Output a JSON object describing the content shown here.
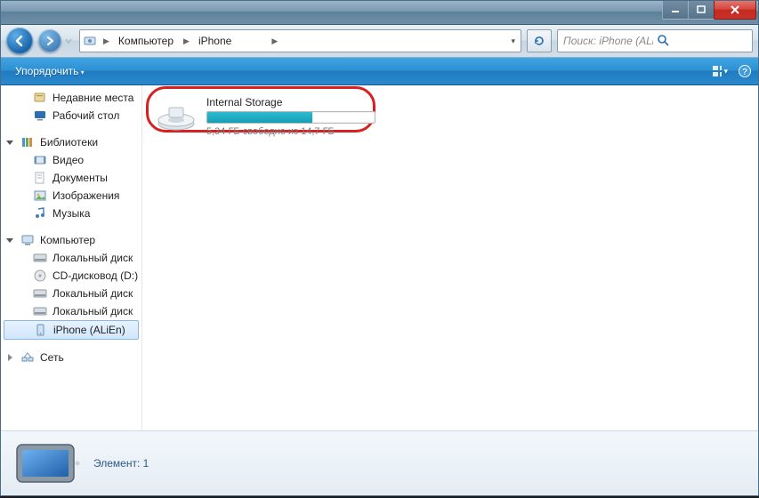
{
  "title_buttons": {
    "minimize": "minimize",
    "maximize": "maximize",
    "close": "close"
  },
  "breadcrumbs": {
    "root_icon": "device",
    "seg1": "Компьютер",
    "seg2": "iPhone"
  },
  "search": {
    "placeholder": "Поиск: iPhone (ALiEn)"
  },
  "toolbar": {
    "organize": "Упорядочить"
  },
  "sidebar": {
    "fav_recent": "Недавние места",
    "fav_desktop": "Рабочий стол",
    "libraries": "Библиотеки",
    "lib_video": "Видео",
    "lib_docs": "Документы",
    "lib_images": "Изображения",
    "lib_music": "Музыка",
    "computer": "Компьютер",
    "local_disk": "Локальный диск",
    "cd_drive": "CD-дисковод (D:)",
    "local_disk2": "Локальный диск",
    "local_disk3": "Локальный диск",
    "iphone": "iPhone (ALiEn)",
    "network": "Сеть"
  },
  "content": {
    "drive_name": "Internal Storage",
    "drive_sub": "5,34 ГБ свободно из 14,7 ГБ",
    "used_percent": 63
  },
  "details": {
    "label": "Элемент: 1"
  }
}
